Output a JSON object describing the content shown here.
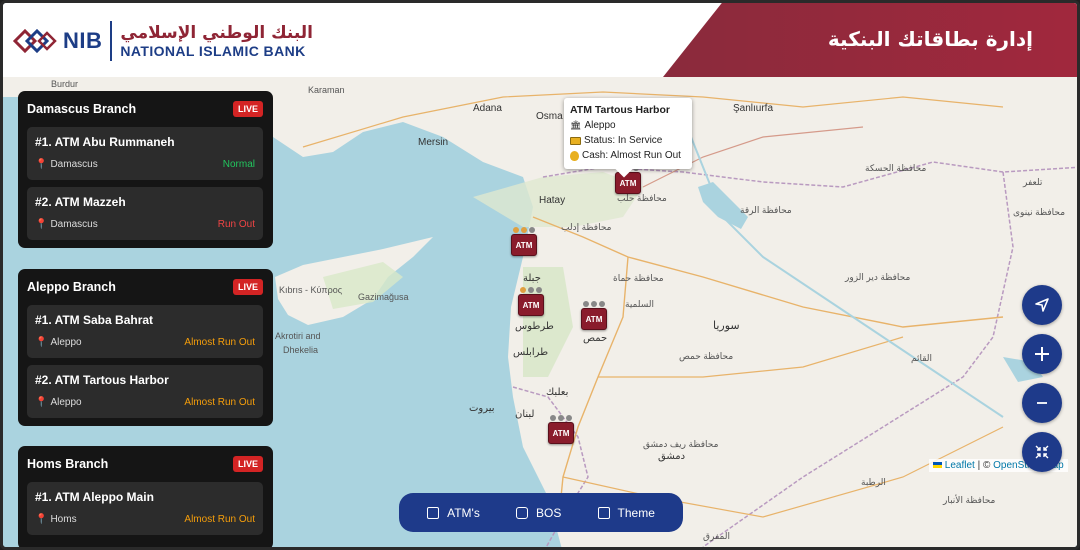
{
  "header": {
    "title": "إدارة بطاقاتك البنكية",
    "logo": {
      "short": "NIB",
      "arabic": "البنك الوطني الإسلامي",
      "english": "NATIONAL ISLAMIC BANK"
    }
  },
  "branches": [
    {
      "title": "Damascus Branch",
      "badge": "LIVE",
      "atms": [
        {
          "name": "#1. ATM Abu Rummaneh",
          "location": "Damascus",
          "status": "Normal",
          "status_color": "#22c55e"
        },
        {
          "name": "#2. ATM Mazzeh",
          "location": "Damascus",
          "status": "Run Out",
          "status_color": "#ef4444"
        }
      ]
    },
    {
      "title": "Aleppo Branch",
      "badge": "LIVE",
      "atms": [
        {
          "name": "#1. ATM Saba Bahrat",
          "location": "Aleppo",
          "status": "Almost Run Out",
          "status_color": "#f59e0b"
        },
        {
          "name": "#2. ATM Tartous Harbor",
          "location": "Aleppo",
          "status": "Almost Run Out",
          "status_color": "#f59e0b"
        }
      ]
    },
    {
      "title": "Homs Branch",
      "badge": "LIVE",
      "atms": [
        {
          "name": "#1. ATM Aleppo Main",
          "location": "Homs",
          "status": "Almost Run Out",
          "status_color": "#f59e0b"
        }
      ]
    }
  ],
  "popup": {
    "title": "ATM Tartous Harbor",
    "location": "Aleppo",
    "status": "Status: In Service",
    "cash": "Cash: Almost Run Out"
  },
  "marker_label": "ATM",
  "map_labels": {
    "burdur": "Burdur",
    "karaman": "Karaman",
    "adana": "Adana",
    "osmaniye": "Osma",
    "sanliurfa": "Şanlıurfa",
    "mersin": "Mersin",
    "hatay": "Hatay",
    "cyprus": "Kıbrıs - Κύπρος",
    "gazimagusa": "Gazimağusa",
    "akrotiri": "Akrotiri and",
    "dhekelia": "Dhekelia",
    "syria": "سوريا",
    "beirut": "بيروت",
    "lebanon": "لبنان",
    "damascus_gov": "محافظة ريف دمشق",
    "damascus": "دمشق",
    "homs": "حمص",
    "homs_gov": "محافظة حمص",
    "hama_gov": "محافظة حماة",
    "tartus": "طرطوس",
    "latakia": "جبلة",
    "raqqa": "محافظة الرقة",
    "hasakah": "محافظة الحسكة",
    "deir": "محافظة دير الزور",
    "anbar": "محافظة الأنبار",
    "qaim": "القائم",
    "rutba": "الرطبة",
    "mafraq": "المفرق",
    "tripoli": "طرابلس",
    "baalbek": "بعلبك",
    "salamiyah": "السلمية",
    "idlib": "محافظة إدلب",
    "aleppo_gov": "محافظة حلب",
    "haditha": "تلعفر",
    "nineveh": "محافظة نينوى"
  },
  "attribution": {
    "leaflet": "Leaflet",
    "sep": " | © ",
    "osm": "OpenStreetMap"
  },
  "nav": [
    {
      "label": "ATM's",
      "icon": "atm-icon"
    },
    {
      "label": "BOS",
      "icon": "bos-icon"
    },
    {
      "label": "Theme",
      "icon": "theme-icon"
    }
  ],
  "colors": {
    "brand_blue": "#1e3a8a",
    "brand_red": "#8a2a3c",
    "panel": "#151515",
    "card": "#2c2c2c"
  }
}
